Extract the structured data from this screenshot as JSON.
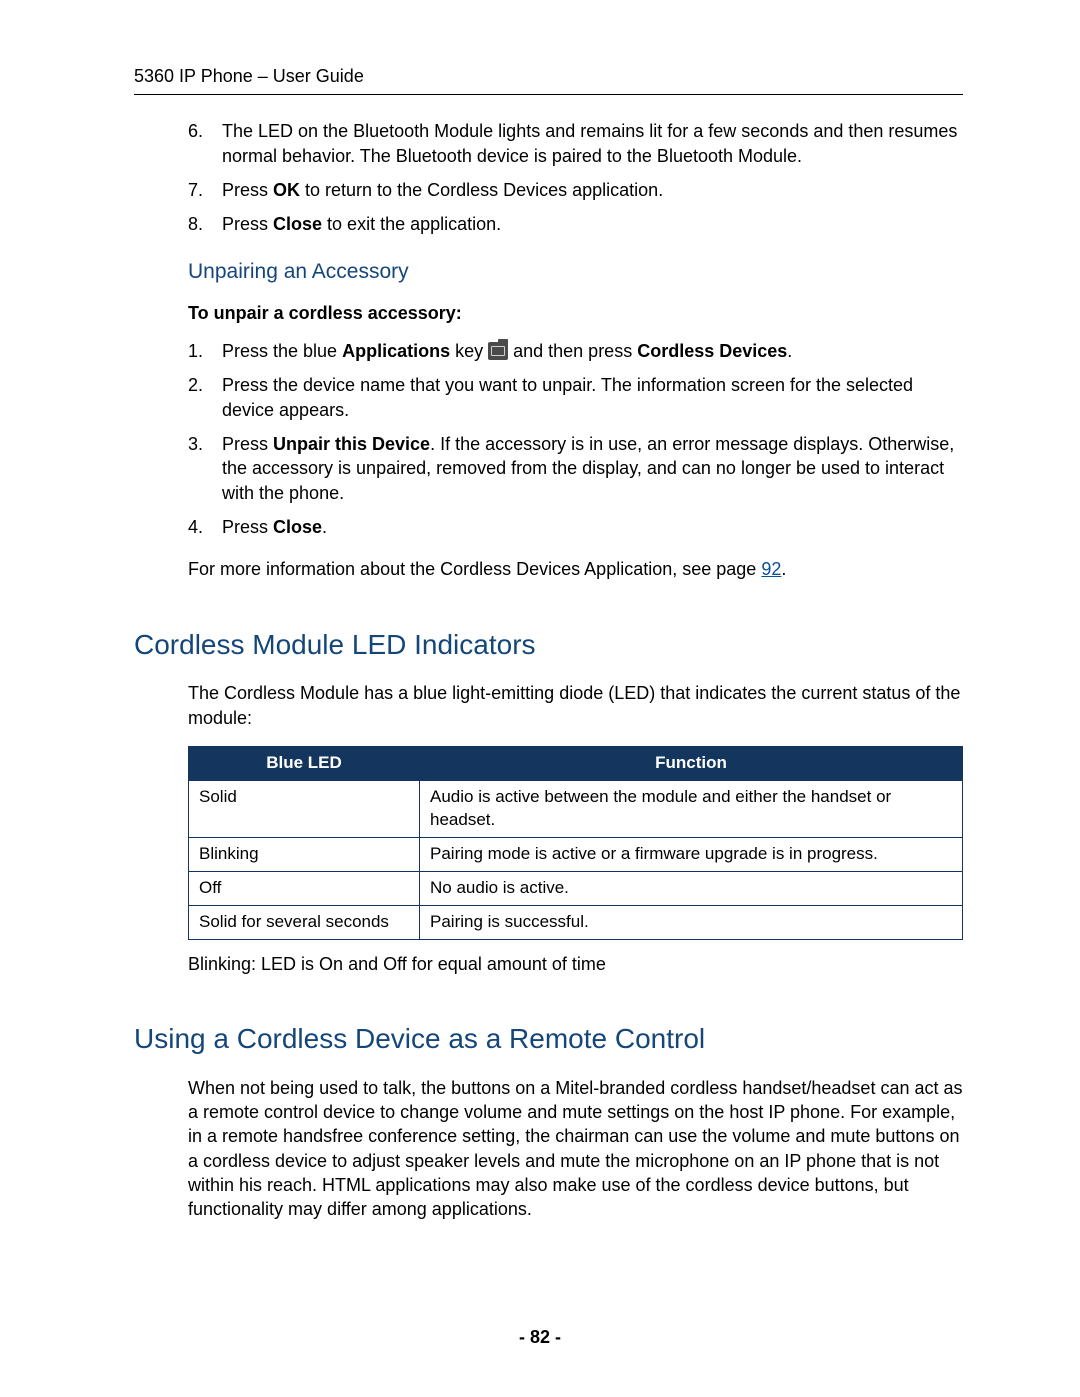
{
  "header": {
    "title": "5360 IP Phone – User Guide"
  },
  "top_list": {
    "item6": {
      "num": "6.",
      "text": "The LED on the Bluetooth Module lights and remains lit for a few seconds and then resumes normal behavior. The Bluetooth device is paired to the Bluetooth Module."
    },
    "item7": {
      "num": "7.",
      "pre": "Press ",
      "bold": "OK",
      "post": " to return to the Cordless Devices application."
    },
    "item8": {
      "num": "8.",
      "pre": "Press ",
      "bold": "Close",
      "post": " to exit the application."
    }
  },
  "unpair": {
    "heading": "Unpairing an Accessory",
    "subheading": "To unpair a cordless accessory:",
    "item1": {
      "num": "1.",
      "pre": "Press the blue ",
      "bold1": "Applications",
      "mid": " key ",
      "post1": " and then press ",
      "bold2": "Cordless Devices",
      "post2": "."
    },
    "item2": {
      "num": "2.",
      "text": "Press the device name that you want to unpair. The information screen for the selected device appears."
    },
    "item3": {
      "num": "3.",
      "pre": "Press ",
      "bold": "Unpair this Device",
      "post": ". If the accessory is in use, an error message displays. Otherwise, the accessory is unpaired, removed from the display, and can no longer be used to interact with the phone."
    },
    "item4": {
      "num": "4.",
      "pre": "Press ",
      "bold": "Close",
      "post": "."
    },
    "more_info_pre": "For more information about the Cordless Devices Application, see page ",
    "more_info_link": "92",
    "more_info_post": "."
  },
  "led_section": {
    "heading": "Cordless Module LED Indicators",
    "intro": "The Cordless Module has a blue light-emitting diode (LED) that indicates the current status of the module:",
    "table": {
      "head_left": "Blue LED",
      "head_right": "Function",
      "rows": [
        {
          "l": "Solid",
          "r": "Audio is active between the module and either the handset or headset."
        },
        {
          "l": "Blinking",
          "r": "Pairing mode is active or a firmware upgrade is in progress."
        },
        {
          "l": "Off",
          "r": "No audio is active."
        },
        {
          "l": "Solid for several seconds",
          "r": "Pairing is successful."
        }
      ]
    },
    "note": "Blinking: LED is On and Off for equal amount of time"
  },
  "remote_section": {
    "heading": "Using a Cordless Device as a Remote Control",
    "para": "When not being used to talk, the buttons on a Mitel-branded cordless handset/headset can act as a remote control device to change volume and mute settings on the host IP phone. For example, in a remote handsfree conference setting, the chairman can use the volume and mute buttons on a cordless device to adjust speaker levels and mute the microphone on an IP phone that is not within his reach. HTML applications may also make use of the cordless device buttons, but functionality may differ among applications."
  },
  "footer": {
    "page": "- 82 -"
  }
}
